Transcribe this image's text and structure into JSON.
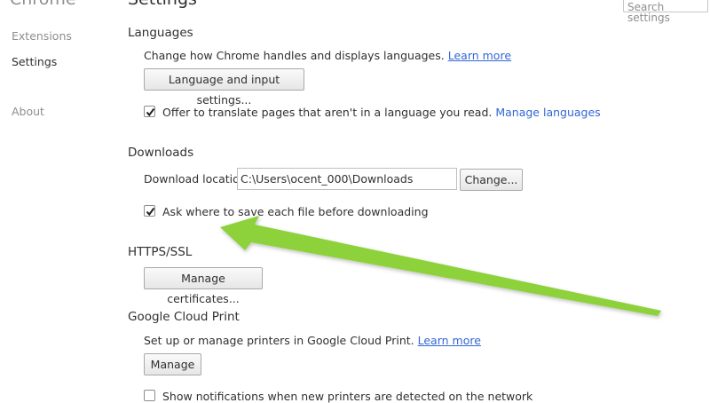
{
  "header": {
    "app_title": "Chrome",
    "page_title": "Settings",
    "search_placeholder": "Search settings"
  },
  "sidebar": {
    "items": [
      {
        "label": "Extensions"
      },
      {
        "label": "Settings"
      },
      {
        "label": "About"
      }
    ]
  },
  "languages": {
    "heading": "Languages",
    "description": "Change how Chrome handles and displays languages.",
    "learn_more": "Learn more",
    "button": "Language and input settings...",
    "translate_label": "Offer to translate pages that aren't in a language you read.",
    "translate_checked": true,
    "manage_link": "Manage languages"
  },
  "downloads": {
    "heading": "Downloads",
    "location_label": "Download location:",
    "location_value": "C:\\Users\\ocent_000\\Downloads",
    "change_button": "Change...",
    "ask_label": "Ask where to save each file before downloading",
    "ask_checked": true
  },
  "https": {
    "heading": "HTTPS/SSL",
    "button": "Manage certificates..."
  },
  "cloud_print": {
    "heading": "Google Cloud Print",
    "description": "Set up or manage printers in Google Cloud Print.",
    "learn_more": "Learn more",
    "button": "Manage",
    "notify_label": "Show notifications when new printers are detected on the network",
    "notify_checked": false
  },
  "annotation": {
    "arrow_color": "#8dd13a"
  }
}
